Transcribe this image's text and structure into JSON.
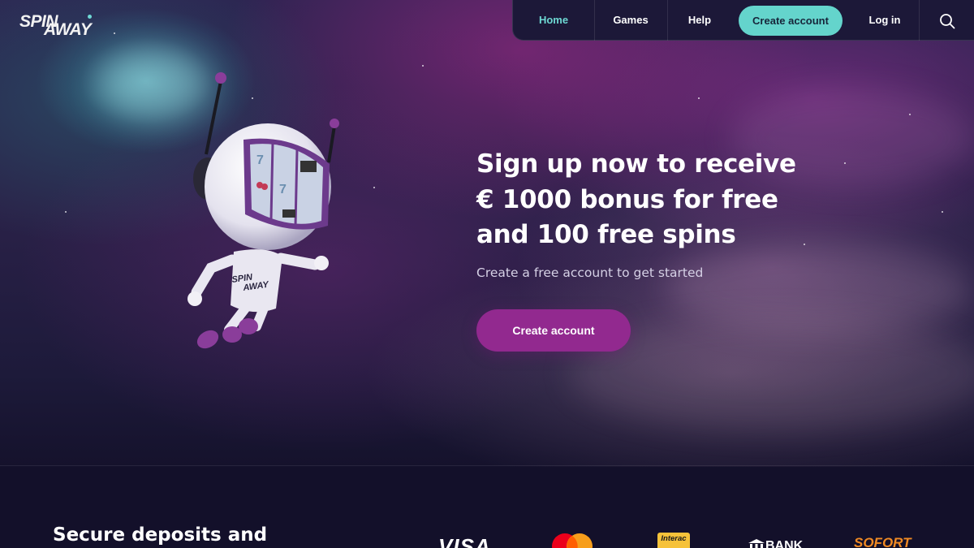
{
  "brand": {
    "name": "SPIN AWAY",
    "logo_line1": "SPIN",
    "logo_line2": "AWAY"
  },
  "nav": {
    "items": [
      {
        "label": "Home",
        "active": true
      },
      {
        "label": "Games",
        "active": false
      },
      {
        "label": "Help",
        "active": false
      }
    ],
    "create_account": "Create account",
    "login": "Log in",
    "search_icon": "search-icon"
  },
  "hero": {
    "headline_lines": [
      "Sign up now to receive",
      "€ 1000 bonus for free",
      "and 100 free spins"
    ],
    "subtitle": "Create a free account to get started",
    "cta": "Create account"
  },
  "payments": {
    "title": "Secure deposits and",
    "logos": [
      {
        "name": "visa",
        "text": "VISA"
      },
      {
        "name": "mastercard",
        "text": ""
      },
      {
        "name": "interac",
        "text": "Interac"
      },
      {
        "name": "bank",
        "text": "BANK"
      },
      {
        "name": "sofort",
        "text": "SOFORT"
      }
    ]
  },
  "colors": {
    "accent_teal": "#64d4cc",
    "accent_purple": "#92298f",
    "nav_bg": "#1c1838",
    "page_bg": "#13102a"
  }
}
